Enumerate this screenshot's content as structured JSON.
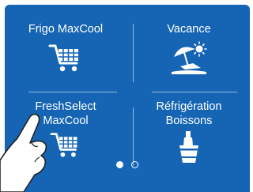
{
  "colors": {
    "panel": "#1565b4",
    "text": "#ffffff",
    "skin": "#ffffff",
    "outline": "#222222"
  },
  "tiles": [
    {
      "label": "Frigo MaxCool",
      "icon": "shopping-cart-icon"
    },
    {
      "label": "Vacance",
      "icon": "beach-umbrella-sun-icon"
    },
    {
      "label": "FreshSelect MaxCool",
      "icon": "shopping-cart-icon"
    },
    {
      "label": "Réfrigération Boissons",
      "icon": "ice-bucket-bottle-icon"
    }
  ],
  "pagination": {
    "pages": 2,
    "current": 1
  },
  "hand": {
    "icon": "pointing-finger-hand-icon"
  }
}
